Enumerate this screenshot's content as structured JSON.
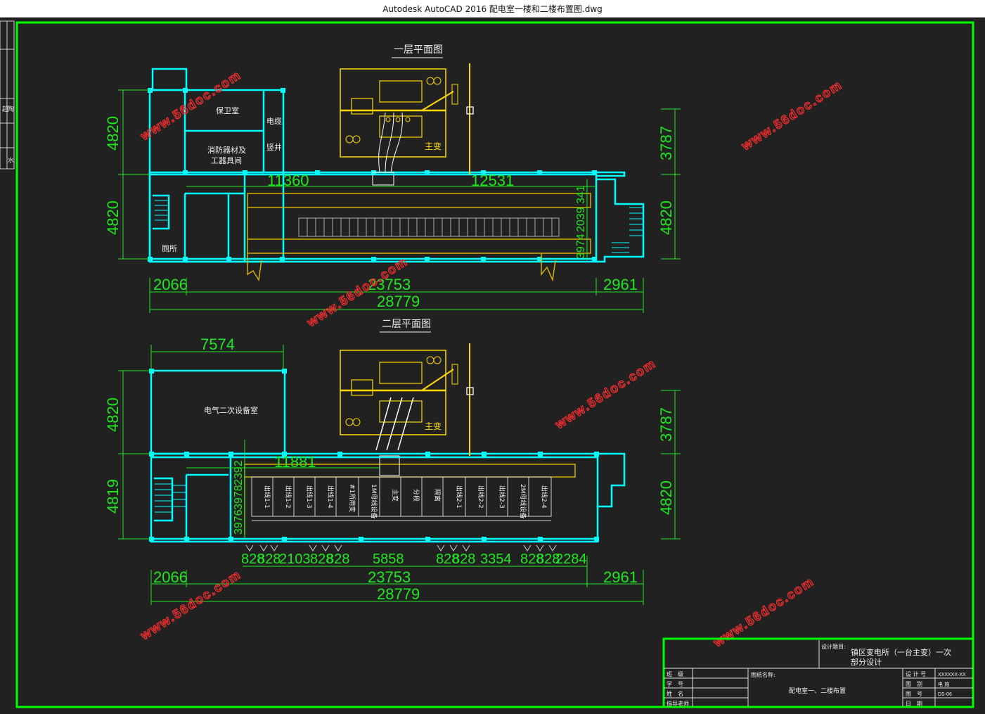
{
  "window": {
    "title": "Autodesk AutoCAD 2016     配电室一楼和二楼布置图.dwg"
  },
  "colors": {
    "frame": "#00ff00",
    "wall": "#00ffff",
    "dim": "#1fe81f",
    "equip": "#ffd700",
    "watermark": "#ff2e2e",
    "text": "#f0f0f0"
  },
  "sidebar": {
    "chars": [
      "超",
      "陶",
      "水"
    ]
  },
  "plan1": {
    "title": "一层平面图",
    "rooms": {
      "guard": "保卫室",
      "cable": "电缆",
      "shaft": "竖井",
      "fire1": "消防器材及",
      "fire2": "工器具间",
      "toilet": "厕所"
    },
    "transformer": "主变",
    "dims": {
      "left_top": "4820",
      "left_bottom": "4820",
      "right_top": "3787",
      "right_bottom": "4820",
      "bus_left": "11360",
      "bus_right": "12531",
      "vert_a": "341",
      "vert_b": "2039",
      "vert_c": "3974",
      "seg_left": "2066",
      "seg_mid": "23753",
      "seg_right": "2961",
      "total": "28779"
    }
  },
  "plan2": {
    "title": "二层平面图",
    "room": "电气二次设备室",
    "transformer": "主变",
    "cabinets": [
      "出线1-1",
      "出线1-2",
      "出线1-3",
      "出线1-4",
      "#1所用变",
      "1M母线设备",
      "主变",
      "分段",
      "隔离",
      "出线2-1",
      "出线2-2",
      "出线2-3",
      "2M母线设备",
      "出线2-4"
    ],
    "dims": {
      "top_room": "7574",
      "left_top": "4820",
      "left_bottom": "4819",
      "right_top": "3787",
      "right_bottom": "4820",
      "bus_left": "11881",
      "vert_a": "2392",
      "vert_b": "3978",
      "vert_c": "3976",
      "cab_a": "828",
      "cab_b": "828",
      "cab_c": "2103",
      "cab_d": "828",
      "cab_e": "828",
      "cab_f": "5858",
      "cab_g": "828",
      "cab_h": "828",
      "cab_i": "3354",
      "cab_j": "828",
      "cab_k": "828",
      "cab_l": "2284",
      "seg_left": "2066",
      "seg_mid": "23753",
      "seg_right": "2961",
      "total": "28779"
    }
  },
  "watermark": "www.56doc.com",
  "titleblock": {
    "project_label": "设计题目:",
    "project_line1": "镇区变电所（一台主变）一次",
    "project_line2": "部分设计",
    "drawing_label": "图纸名称:",
    "drawing_name": "配电室一、二楼布置",
    "rows_left": [
      "班　级",
      "学　号",
      "姓　名",
      "指导老师"
    ],
    "rows_right": [
      "设 计 号",
      "图　别",
      "图　号",
      "日　期"
    ],
    "right_vals": [
      "XXXXXX-XX",
      "电 施",
      "DS-06",
      ""
    ]
  }
}
